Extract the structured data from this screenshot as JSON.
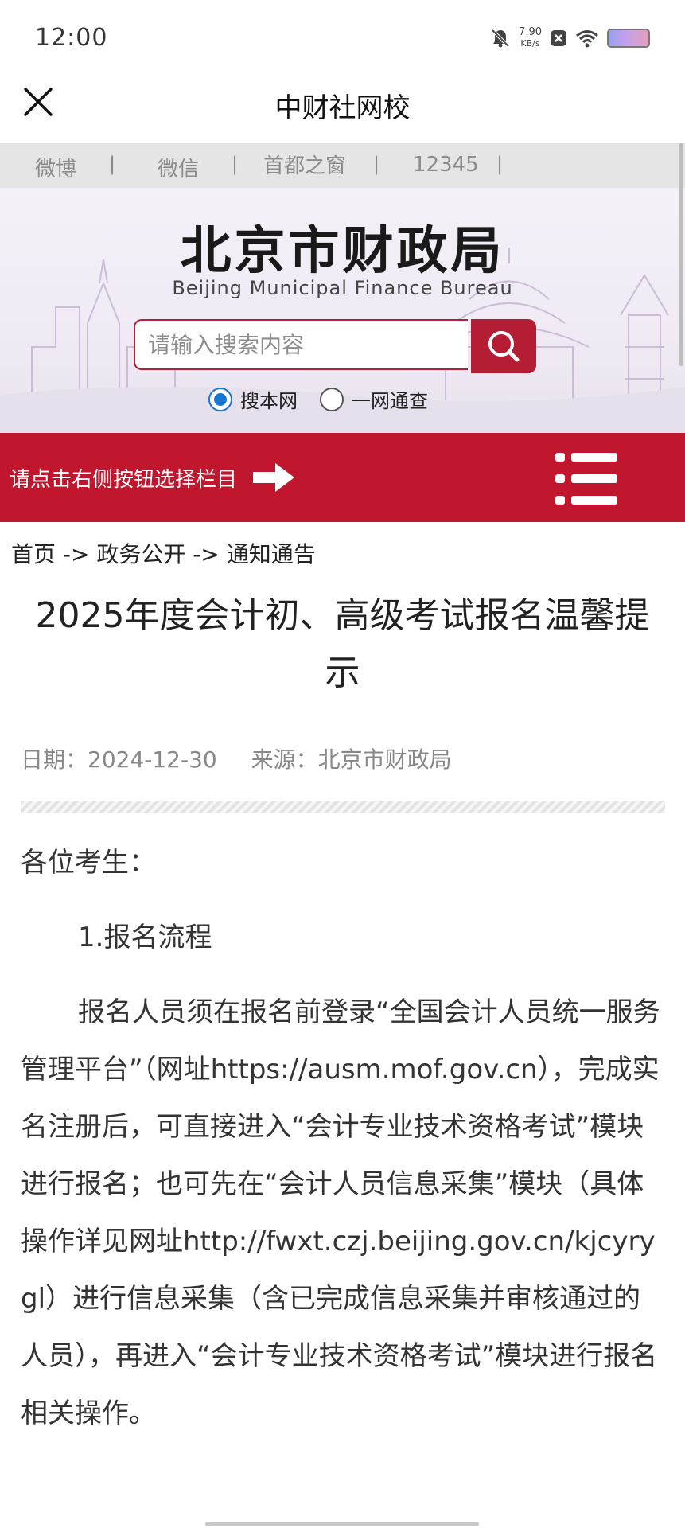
{
  "status": {
    "time": "12:00",
    "net_speed_value": "7.90",
    "net_speed_unit": "KB/s"
  },
  "app": {
    "title": "中财社网校"
  },
  "top_links": [
    "微博",
    "微信",
    "首都之窗",
    "12345"
  ],
  "banner": {
    "title": "北京市财政局",
    "subtitle": "Beijing Municipal Finance Bureau",
    "search_placeholder": "请输入搜索内容",
    "radio_options": [
      {
        "label": "搜本网",
        "checked": true
      },
      {
        "label": "一网通查",
        "checked": false
      }
    ]
  },
  "nav": {
    "hint": "请点击右侧按钮选择栏目"
  },
  "breadcrumb": "首页 -> 政务公开 -> 通知通告",
  "article": {
    "title": "2025年度会计初、高级考试报名温馨提示",
    "date_label": "日期：2024-12-30",
    "source_label": "来源：北京市财政局",
    "salutation": "各位考生：",
    "section1": "1.报名流程",
    "paragraph1": "报名人员须在报名前登录“全国会计人员统一服务管理平台”（网址https://ausm.mof.gov.cn），完成实名注册后，可直接进入“会计专业技术资格考试”模块进行报名；也可先在“会计人员信息采集”模块（具体操作详见网址http://fwxt.czj.beijing.gov.cn/kjcyrygl）进行信息采集（含已完成信息采集并审核通过的人员），再进入“会计专业技术资格考试”模块进行报名相关操作。"
  },
  "colors": {
    "accent_red": "#c0172f",
    "radio_blue": "#1976d2"
  }
}
